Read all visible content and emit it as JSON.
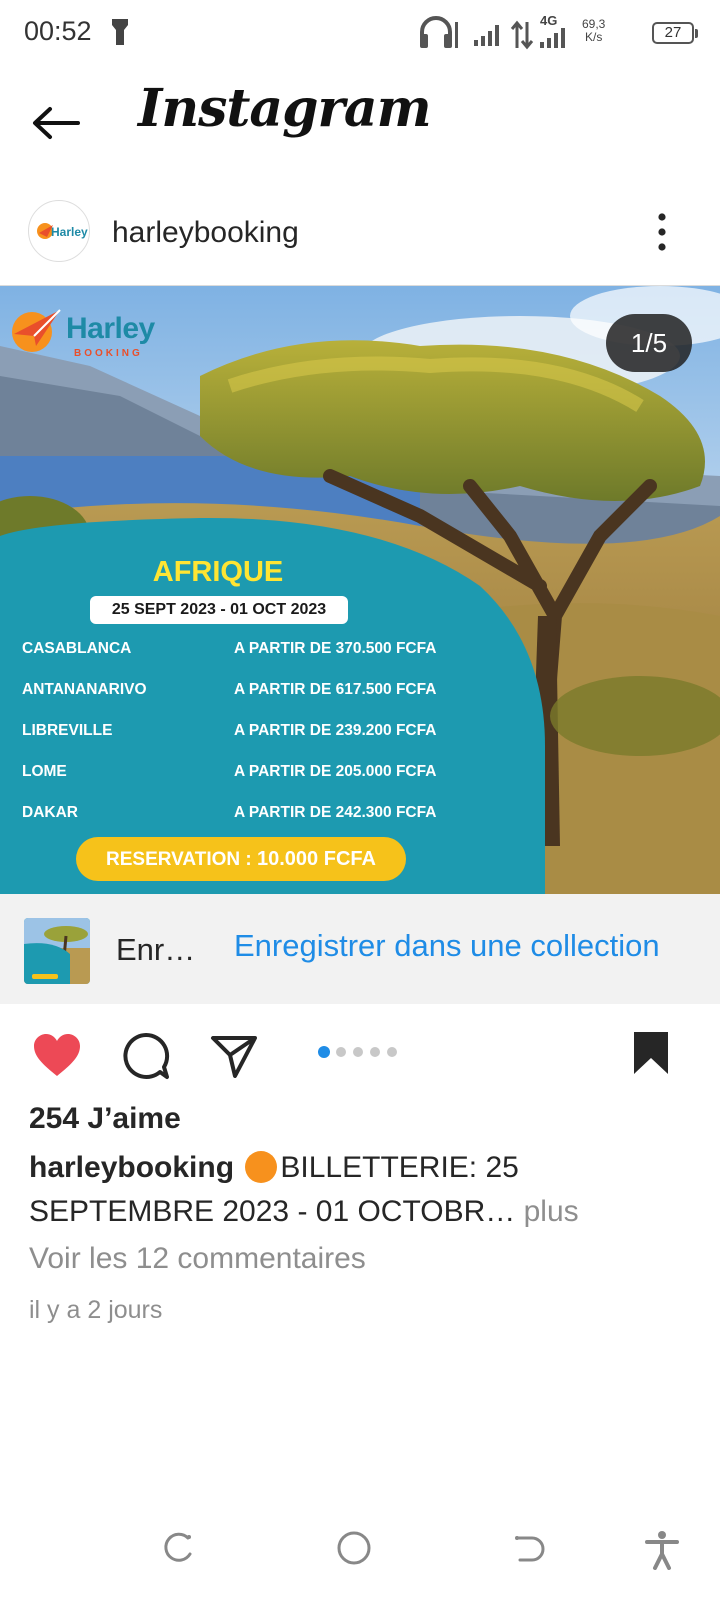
{
  "status_bar": {
    "time": "00:52",
    "network": "4G",
    "speed_value": "69,3",
    "speed_unit": "K/s",
    "battery": "27"
  },
  "header": {
    "app_title": "Instagram"
  },
  "post": {
    "username": "harleybooking",
    "image_counter": "1/5",
    "image": {
      "brand_name": "Harley",
      "brand_sub": "BOOKING",
      "title": "AFRIQUE",
      "dates": "25 SEPT 2023 - 01 OCT 2023",
      "routes": [
        {
          "city": "CASABLANCA",
          "price": "A PARTIR DE 370.500 FCFA"
        },
        {
          "city": "ANTANANARIVO",
          "price": "A PARTIR DE 617.500 FCFA"
        },
        {
          "city": "LIBREVILLE",
          "price": "A PARTIR DE 239.200 FCFA"
        },
        {
          "city": "LOME",
          "price": "A PARTIR DE 205.000 FCFA"
        },
        {
          "city": "DAKAR",
          "price": "A PARTIR DE 242.300 FCFA"
        }
      ],
      "reservation_label": "RESERVATION :",
      "reservation_value": "10.000 FCFA"
    },
    "save_banner": {
      "label": "Enr…",
      "collection_link": "Enregistrer dans une collection"
    },
    "carousel": {
      "count": 5,
      "active_index": 0
    },
    "likes": "254 J’aime",
    "caption_user": "harleybooking",
    "caption_text": "BILLETTERIE: 25 SEPTEMBRE 2023 - 01 OCTOBR…",
    "caption_more": "plus",
    "comments_link": "Voir les 12 commentaires",
    "timestamp": "il y a 2 jours"
  },
  "colors": {
    "like": "#ed4956",
    "link": "#1f8ce6",
    "teal_panel": "#1d9ab0",
    "reservation": "#f6c21a",
    "promo_title": "#ffe533"
  },
  "icons": [
    "back-arrow-icon",
    "more-icon",
    "heart-icon",
    "comment-icon",
    "share-icon",
    "bookmark-icon",
    "torch-icon",
    "headphones-icon",
    "signal-icon",
    "battery-icon",
    "recent-apps-icon",
    "home-icon",
    "back-nav-icon",
    "accessibility-icon"
  ]
}
